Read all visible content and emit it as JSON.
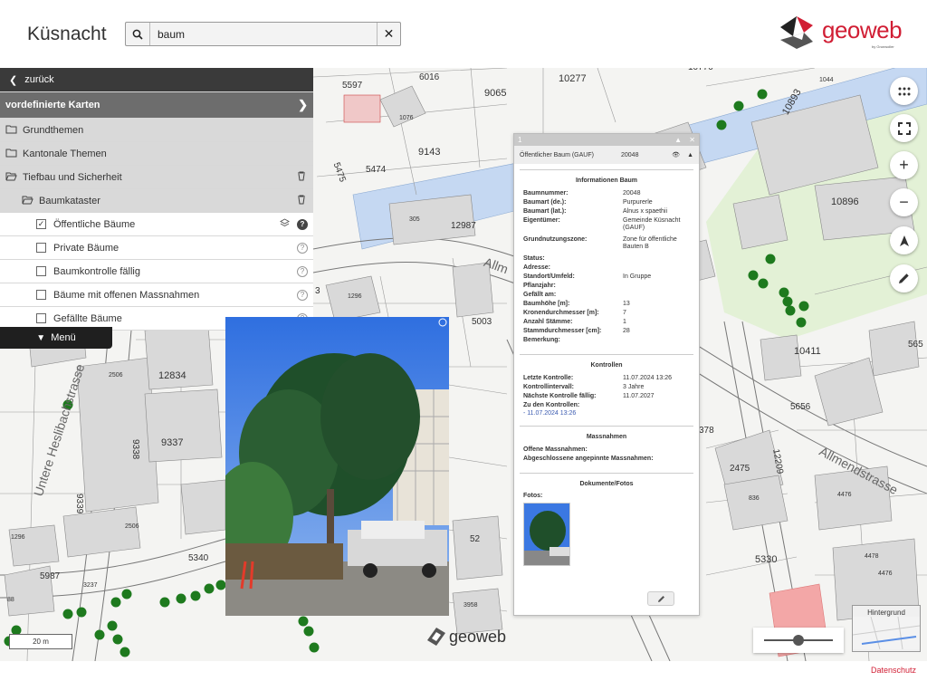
{
  "header": {
    "title": "Küsnacht",
    "search_value": "baum",
    "logo_text": "geoweb",
    "logo_by": "by Grunwoller"
  },
  "panel": {
    "back_label": "zurück",
    "predefined_label": "vordefinierte Karten",
    "groups": [
      {
        "label": "Grundthemen"
      },
      {
        "label": "Kantonale Themen"
      },
      {
        "label": "Tiefbau und Sicherheit"
      }
    ],
    "subgroup": "Baumkataster",
    "layers": [
      {
        "label": "Öffentliche Bäume",
        "checked": true
      },
      {
        "label": "Private Bäume",
        "checked": false
      },
      {
        "label": "Baumkontrolle fällig",
        "checked": false
      },
      {
        "label": "Bäume mit offenen Massnahmen",
        "checked": false
      },
      {
        "label": "Gefällte Bäume",
        "checked": false
      }
    ],
    "menu_label": "Menü"
  },
  "popup": {
    "index": "1",
    "layer_name": "Öffentlicher Baum (GAUF)",
    "object_id": "20048",
    "section_info": "Informationen Baum",
    "info_rows": [
      {
        "k": "Baumnummer:",
        "v": "20048"
      },
      {
        "k": "Baumart (de.):",
        "v": "Purpurerle"
      },
      {
        "k": "Baumart (lat.):",
        "v": "Alnus x spaethii"
      },
      {
        "k": "Eigentümer:",
        "v": "Gemeinde Küsnacht (GAUF)"
      },
      {
        "k": "Grundnutzungszone:",
        "v": "Zone für öffentliche Bauten B"
      },
      {
        "k": "Status:",
        "v": ""
      },
      {
        "k": "Adresse:",
        "v": ""
      },
      {
        "k": "Standort/Umfeld:",
        "v": "In Gruppe"
      },
      {
        "k": "Pflanzjahr:",
        "v": ""
      },
      {
        "k": "Gefällt am:",
        "v": ""
      },
      {
        "k": "Baumhöhe [m]:",
        "v": "13"
      },
      {
        "k": "Kronendurchmesser [m]:",
        "v": "7"
      },
      {
        "k": "Anzahl Stämme:",
        "v": "1"
      },
      {
        "k": "Stammdurchmesser [cm]:",
        "v": "28"
      },
      {
        "k": "Bemerkung:",
        "v": ""
      }
    ],
    "section_controls": "Kontrollen",
    "control_rows": [
      {
        "k": "Letzte Kontrolle:",
        "v": "11.07.2024 13:26"
      },
      {
        "k": "Kontrollintervall:",
        "v": "3 Jahre"
      },
      {
        "k": "Nächste Kontrolle fällig:",
        "v": "11.07.2027"
      },
      {
        "k": "Zu den Kontrollen:",
        "v": ""
      }
    ],
    "control_link": "- 11.07.2024 13:26",
    "section_measures": "Massnahmen",
    "measure_rows": [
      {
        "k": "Offene Massnahmen:",
        "v": ""
      },
      {
        "k": "Abgeschlossene angepinnte Massnahmen:",
        "v": ""
      }
    ],
    "section_docs": "Dokumente/Fotos",
    "photos_label": "Fotos:"
  },
  "map": {
    "parcels": [
      "6016",
      "5597",
      "9065",
      "10277",
      "10770",
      "10893",
      "1044",
      "10896",
      "9143",
      "5474",
      "5475",
      "12987",
      "5003",
      "3",
      "10411",
      "5656",
      "565",
      "12834",
      "9337",
      "9338",
      "9339",
      "5340",
      "5987",
      "3237",
      "378",
      "2475",
      "12209",
      "5330",
      "2506",
      "2506",
      "1296",
      "1076",
      "305",
      "836",
      "52",
      "3958",
      "4476",
      "4478",
      "4476",
      "1296",
      "88"
    ],
    "streets": [
      "Untere Heslibachstrasse",
      "Allmendstrasse",
      "Allm"
    ],
    "scale_label": "20 m",
    "background_label": "Hintergrund",
    "footer_logo": "geoweb",
    "privacy_label": "Datenschutz"
  },
  "colors": {
    "brand": "#d11e34",
    "tree": "#1e7a1e",
    "water": "#c5d8f2",
    "green_area": "#e3f1d6"
  }
}
